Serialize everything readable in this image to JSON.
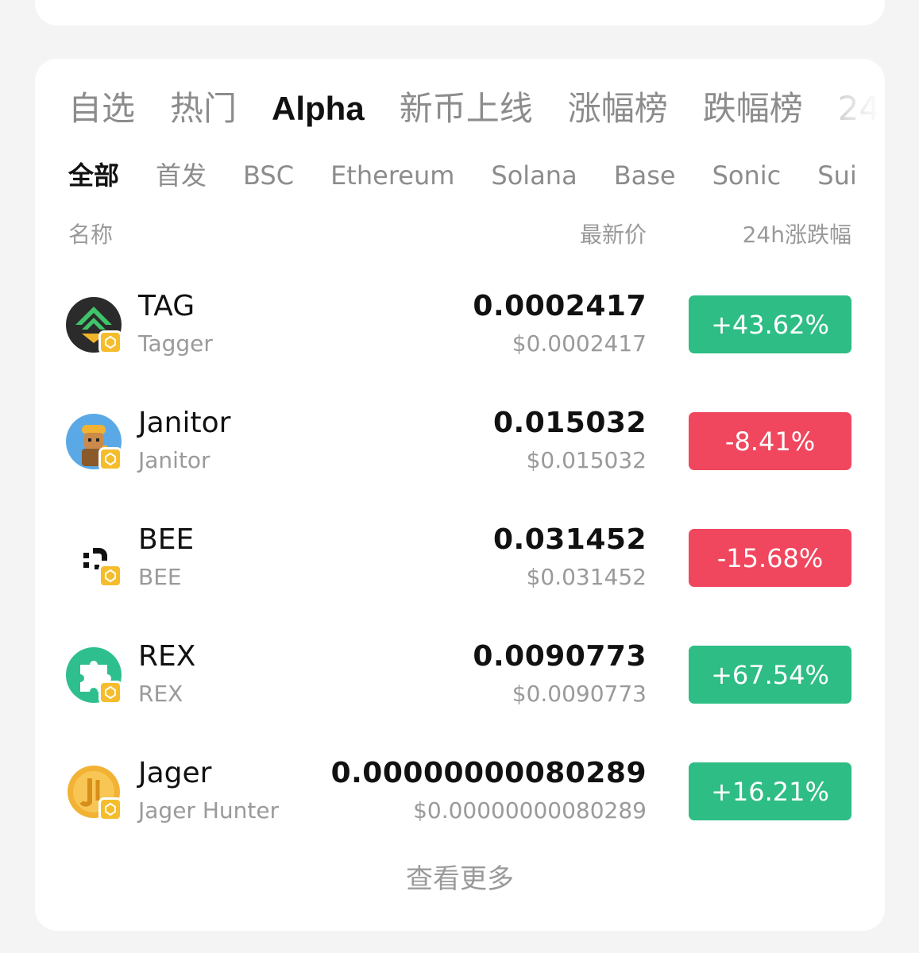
{
  "main_tabs": [
    "自选",
    "热门",
    "Alpha",
    "新币上线",
    "涨幅榜",
    "跌幅榜",
    "24"
  ],
  "main_tab_active": "Alpha",
  "sub_tabs": [
    "全部",
    "首发",
    "BSC",
    "Ethereum",
    "Solana",
    "Base",
    "Sonic",
    "Sui"
  ],
  "sub_tab_active": "全部",
  "columns": {
    "name": "名称",
    "price": "最新价",
    "change": "24h涨跌幅"
  },
  "colors": {
    "up": "#2ebd85",
    "down": "#f0475e",
    "chain_badge": "#f5bd2c"
  },
  "rows": [
    {
      "symbol": "TAG",
      "name": "Tagger",
      "price": "0.0002417",
      "price_usd": "$0.0002417",
      "change": "+43.62%",
      "direction": "up",
      "icon": "tagger-logo-icon"
    },
    {
      "symbol": "Janitor",
      "name": "Janitor",
      "price": "0.015032",
      "price_usd": "$0.015032",
      "change": "-8.41%",
      "direction": "down",
      "icon": "janitor-logo-icon"
    },
    {
      "symbol": "BEE",
      "name": "BEE",
      "price": "0.031452",
      "price_usd": "$0.031452",
      "change": "-15.68%",
      "direction": "down",
      "icon": "bee-logo-icon"
    },
    {
      "symbol": "REX",
      "name": "REX",
      "price": "0.0090773",
      "price_usd": "$0.0090773",
      "change": "+67.54%",
      "direction": "up",
      "icon": "rex-logo-icon"
    },
    {
      "symbol": "Jager",
      "name": "Jager Hunter",
      "price": "0.00000000080289",
      "price_usd": "$0.00000000080289",
      "change": "+16.21%",
      "direction": "up",
      "icon": "jager-logo-icon"
    }
  ],
  "view_more": "查看更多"
}
